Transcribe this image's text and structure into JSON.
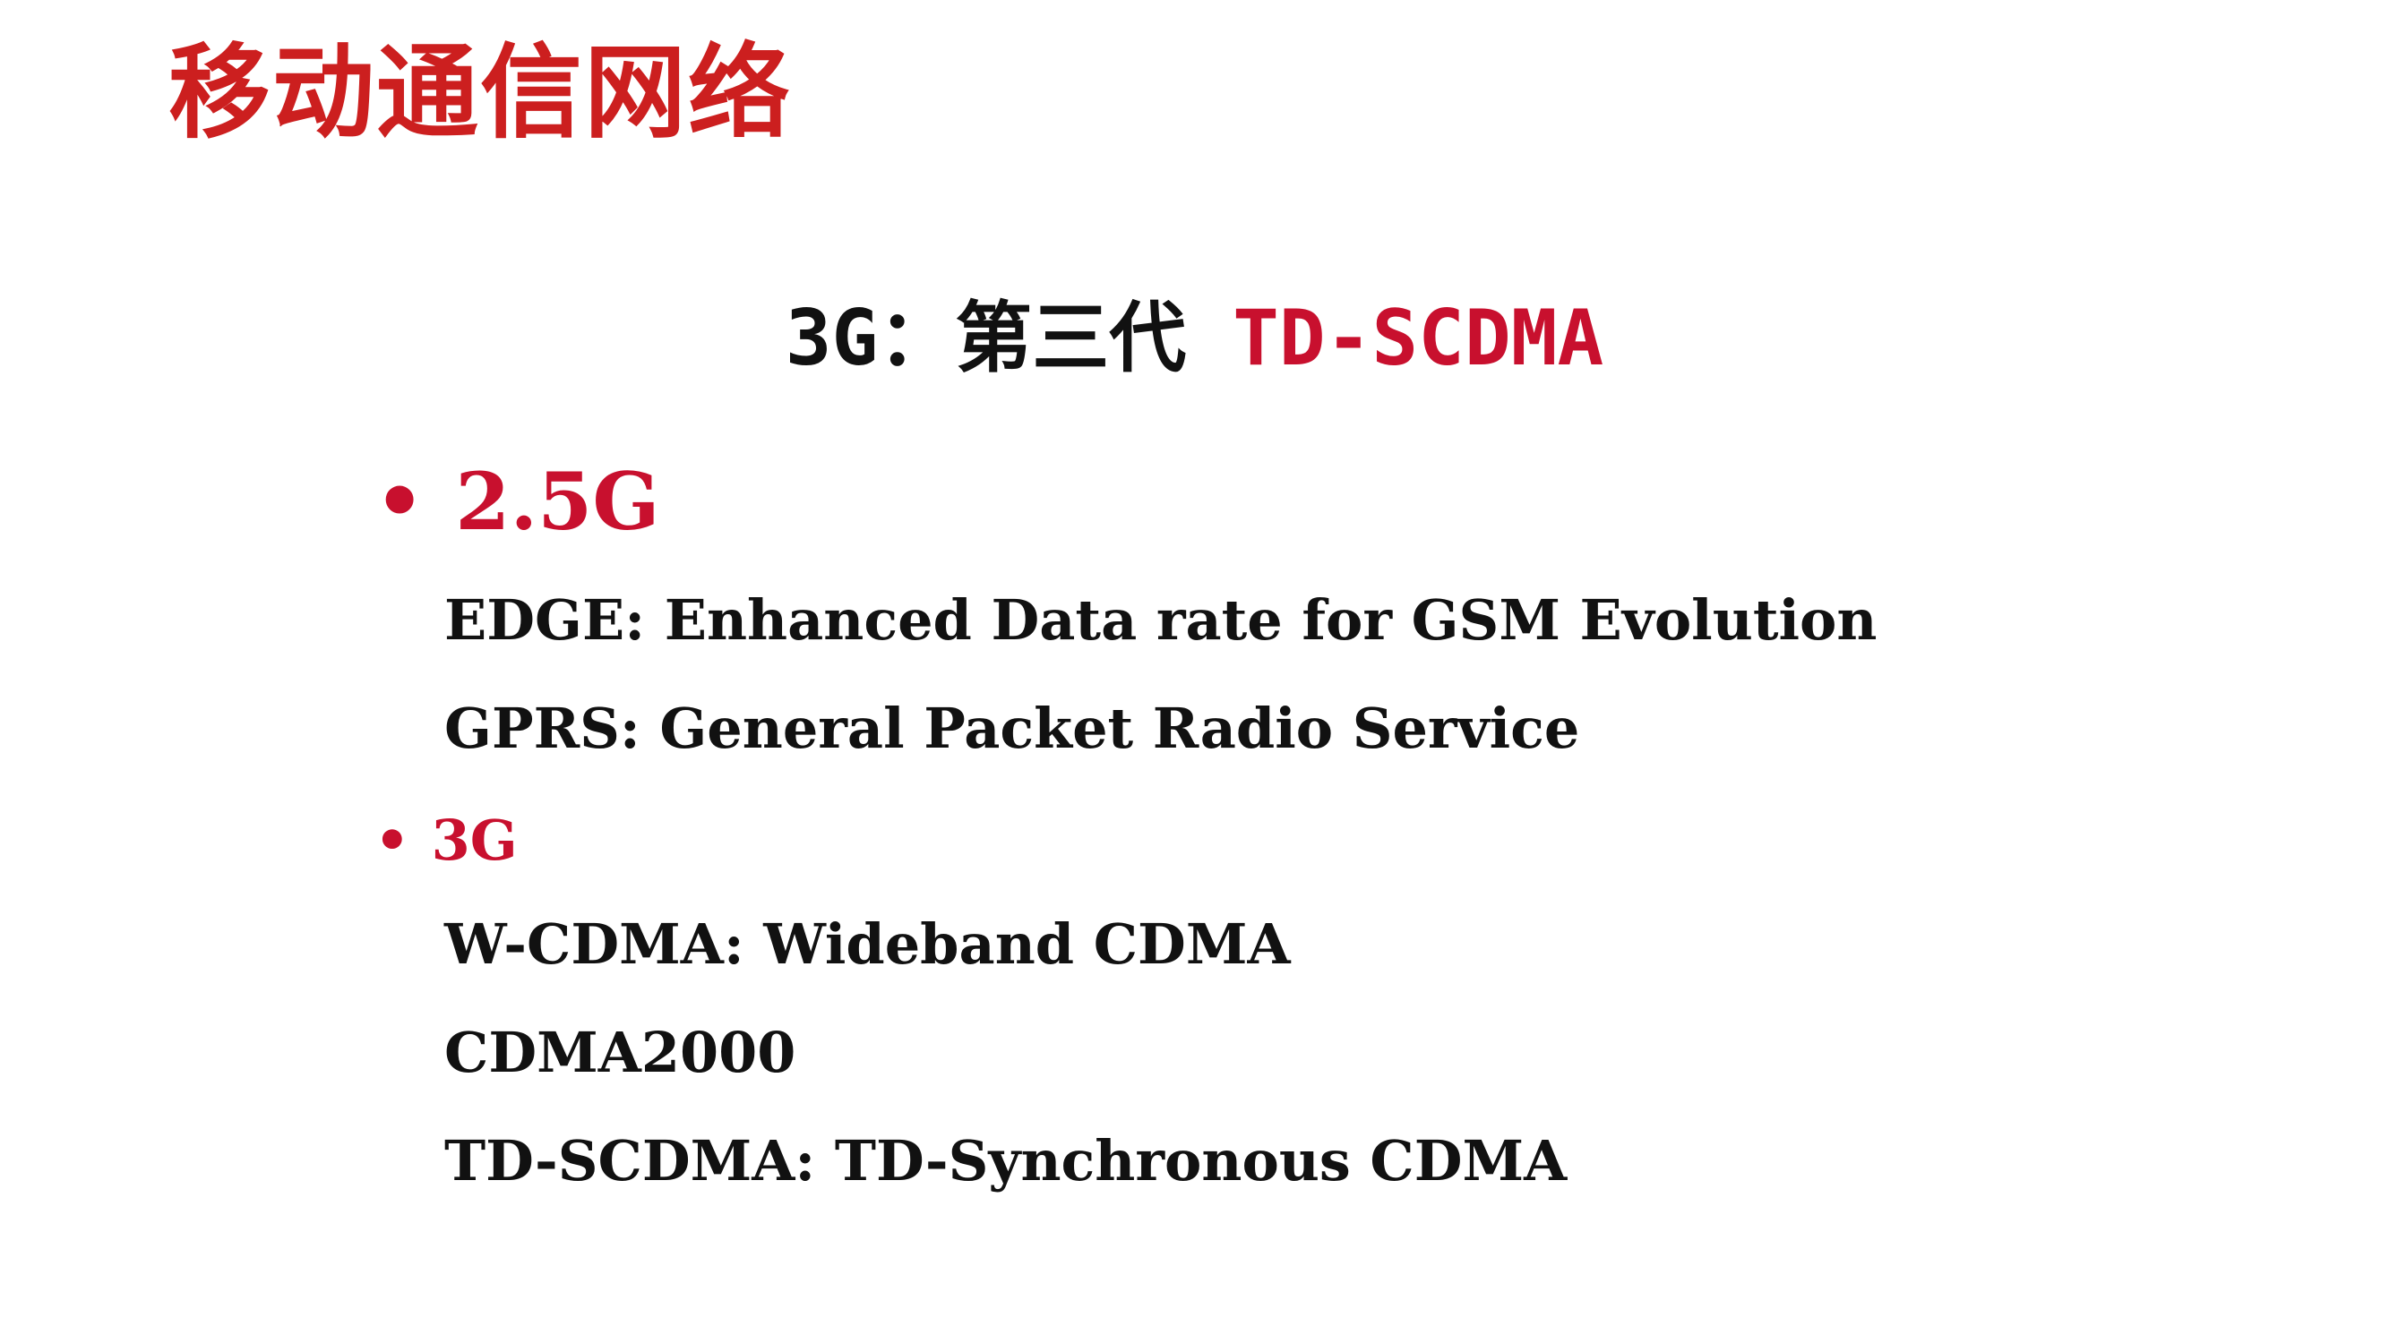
{
  "slide": {
    "title": "移动通信网络",
    "subtitle": {
      "generation": "3G：第三代",
      "technology": "TD-SCDMA"
    },
    "sections": [
      {
        "bullet": "•",
        "heading": "2.5G",
        "items": [
          "EDGE: Enhanced Data rate for GSM Evolution",
          "GPRS: General Packet Radio Service"
        ]
      },
      {
        "bullet": "•",
        "heading": "3G",
        "items": [
          "W-CDMA: Wideband CDMA",
          "CDMA2000",
          "TD-SCDMA: TD-Synchronous CDMA"
        ]
      }
    ],
    "colors": {
      "title": "#cc1f1f",
      "accent": "#c8102e",
      "text": "#111111",
      "background": "#ffffff"
    }
  }
}
